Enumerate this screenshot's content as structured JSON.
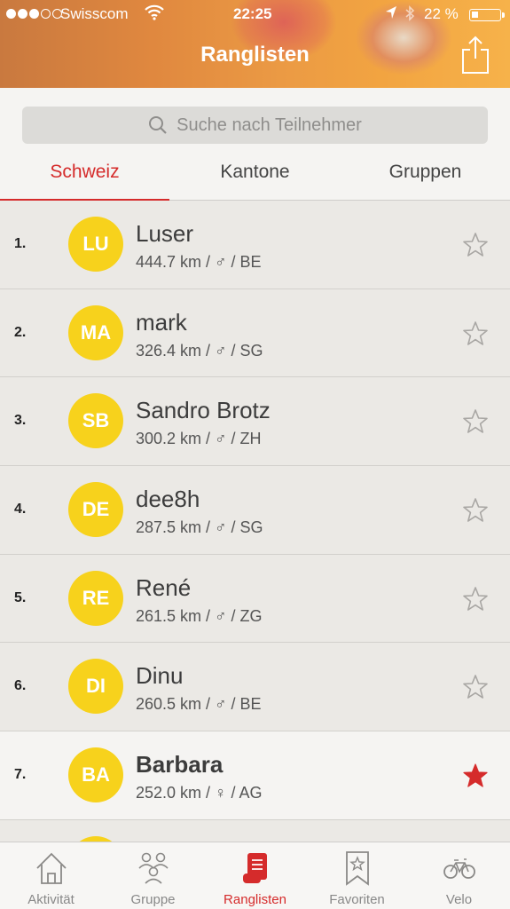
{
  "status_bar": {
    "carrier": "Swisscom",
    "time": "22:25",
    "battery_pct": "22 %"
  },
  "header": {
    "title": "Ranglisten"
  },
  "search": {
    "placeholder": "Suche nach Teilnehmer"
  },
  "tabs": [
    {
      "label": "Schweiz",
      "active": true
    },
    {
      "label": "Kantone",
      "active": false
    },
    {
      "label": "Gruppen",
      "active": false
    }
  ],
  "ranking": [
    {
      "rank": "1.",
      "initials": "LU",
      "name": "Luser",
      "meta": "444.7 km / ♂ / BE",
      "favorite": false
    },
    {
      "rank": "2.",
      "initials": "MA",
      "name": "mark",
      "meta": "326.4 km / ♂ / SG",
      "favorite": false
    },
    {
      "rank": "3.",
      "initials": "SB",
      "name": "Sandro Brotz",
      "meta": "300.2 km / ♂ / ZH",
      "favorite": false
    },
    {
      "rank": "4.",
      "initials": "DE",
      "name": "dee8h",
      "meta": "287.5 km / ♂ / SG",
      "favorite": false
    },
    {
      "rank": "5.",
      "initials": "RE",
      "name": "René",
      "meta": "261.5 km / ♂ / ZG",
      "favorite": false
    },
    {
      "rank": "6.",
      "initials": "DI",
      "name": "Dinu",
      "meta": "260.5 km / ♂ / BE",
      "favorite": false
    },
    {
      "rank": "7.",
      "initials": "BA",
      "name": "Barbara",
      "meta": "252.0 km /  ♀ / AG",
      "favorite": true
    }
  ],
  "tabbar": [
    {
      "label": "Aktivität",
      "icon": "home-icon",
      "active": false
    },
    {
      "label": "Gruppe",
      "icon": "group-icon",
      "active": false
    },
    {
      "label": "Ranglisten",
      "icon": "ranking-scroll-icon",
      "active": true
    },
    {
      "label": "Favoriten",
      "icon": "bookmark-star-icon",
      "active": false
    },
    {
      "label": "Velo",
      "icon": "bicycle-icon",
      "active": false
    }
  ],
  "colors": {
    "accent": "#d52b2b",
    "avatar": "#f7d21c",
    "header": "#e8913f"
  }
}
